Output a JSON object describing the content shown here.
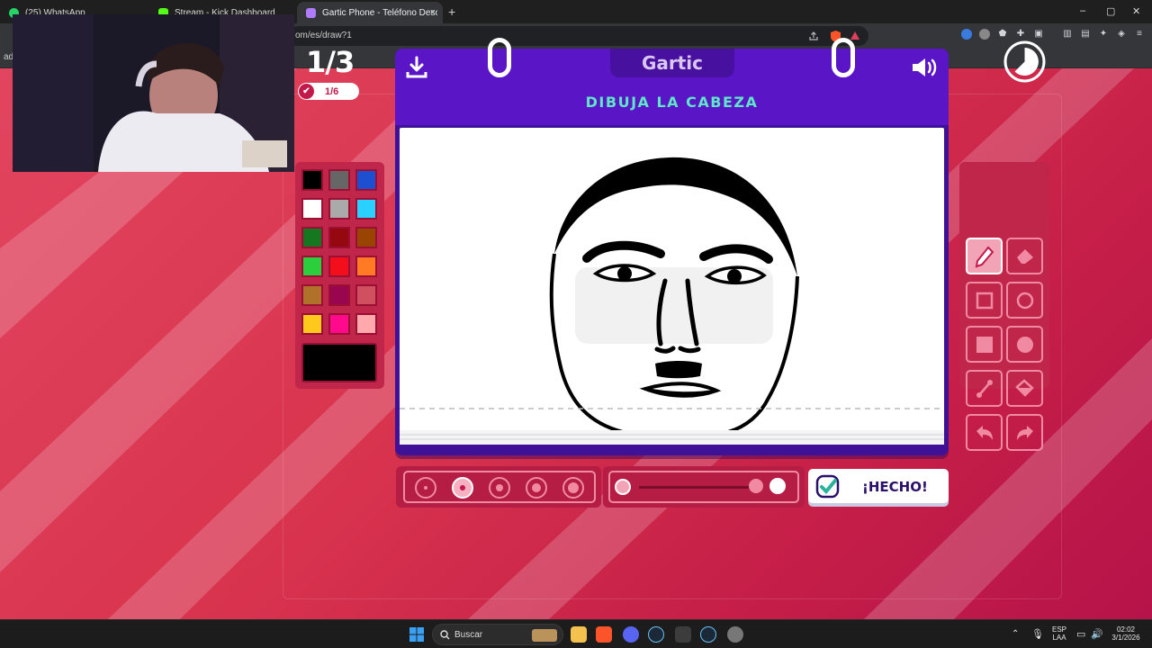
{
  "browser": {
    "tabs": [
      {
        "label": "(25) WhatsApp",
        "active": false
      },
      {
        "label": "Stream - Kick Dashboard",
        "active": false
      },
      {
        "label": "Gartic Phone - Teléfono Descom",
        "active": true
      }
    ],
    "close_glyph": "×",
    "new_tab_glyph": "+",
    "url": "om/es/draw?1",
    "window_controls": [
      "–",
      "▢",
      "✕"
    ],
    "left_edge_label": "ad"
  },
  "game": {
    "round": "1/3",
    "players_done": "1/6",
    "logo": "Gartic",
    "prompt": "DIBUJA LA CABEZA",
    "done_button": "¡HECHO!",
    "palette": [
      "#000000",
      "#666666",
      "#1d4fd1",
      "#ffffff",
      "#aaaaaa",
      "#2ad0ff",
      "#15771f",
      "#96080f",
      "#994400",
      "#2bcf3e",
      "#f20f1b",
      "#ff7a22",
      "#b0722b",
      "#99054f",
      "#d05060",
      "#ffc81d",
      "#ff0a8c",
      "#ffa9ad"
    ],
    "selected_color": "#000000",
    "brush_sizes": [
      1,
      2,
      3,
      4,
      5
    ],
    "selected_brush_size": 2,
    "opacity_level": 1.0,
    "active_tool": "pencil",
    "tools": [
      "pencil-icon",
      "eraser-icon",
      "rectangle-icon",
      "ellipse-icon",
      "filled-rectangle-icon",
      "filled-ellipse-icon",
      "line-icon",
      "bucket-icon",
      "undo-icon",
      "redo-icon"
    ]
  },
  "taskbar": {
    "search_label": "Buscar",
    "language": "ESP",
    "language_sub": "LAA",
    "time": "02:02",
    "date": "3/1/2026"
  }
}
